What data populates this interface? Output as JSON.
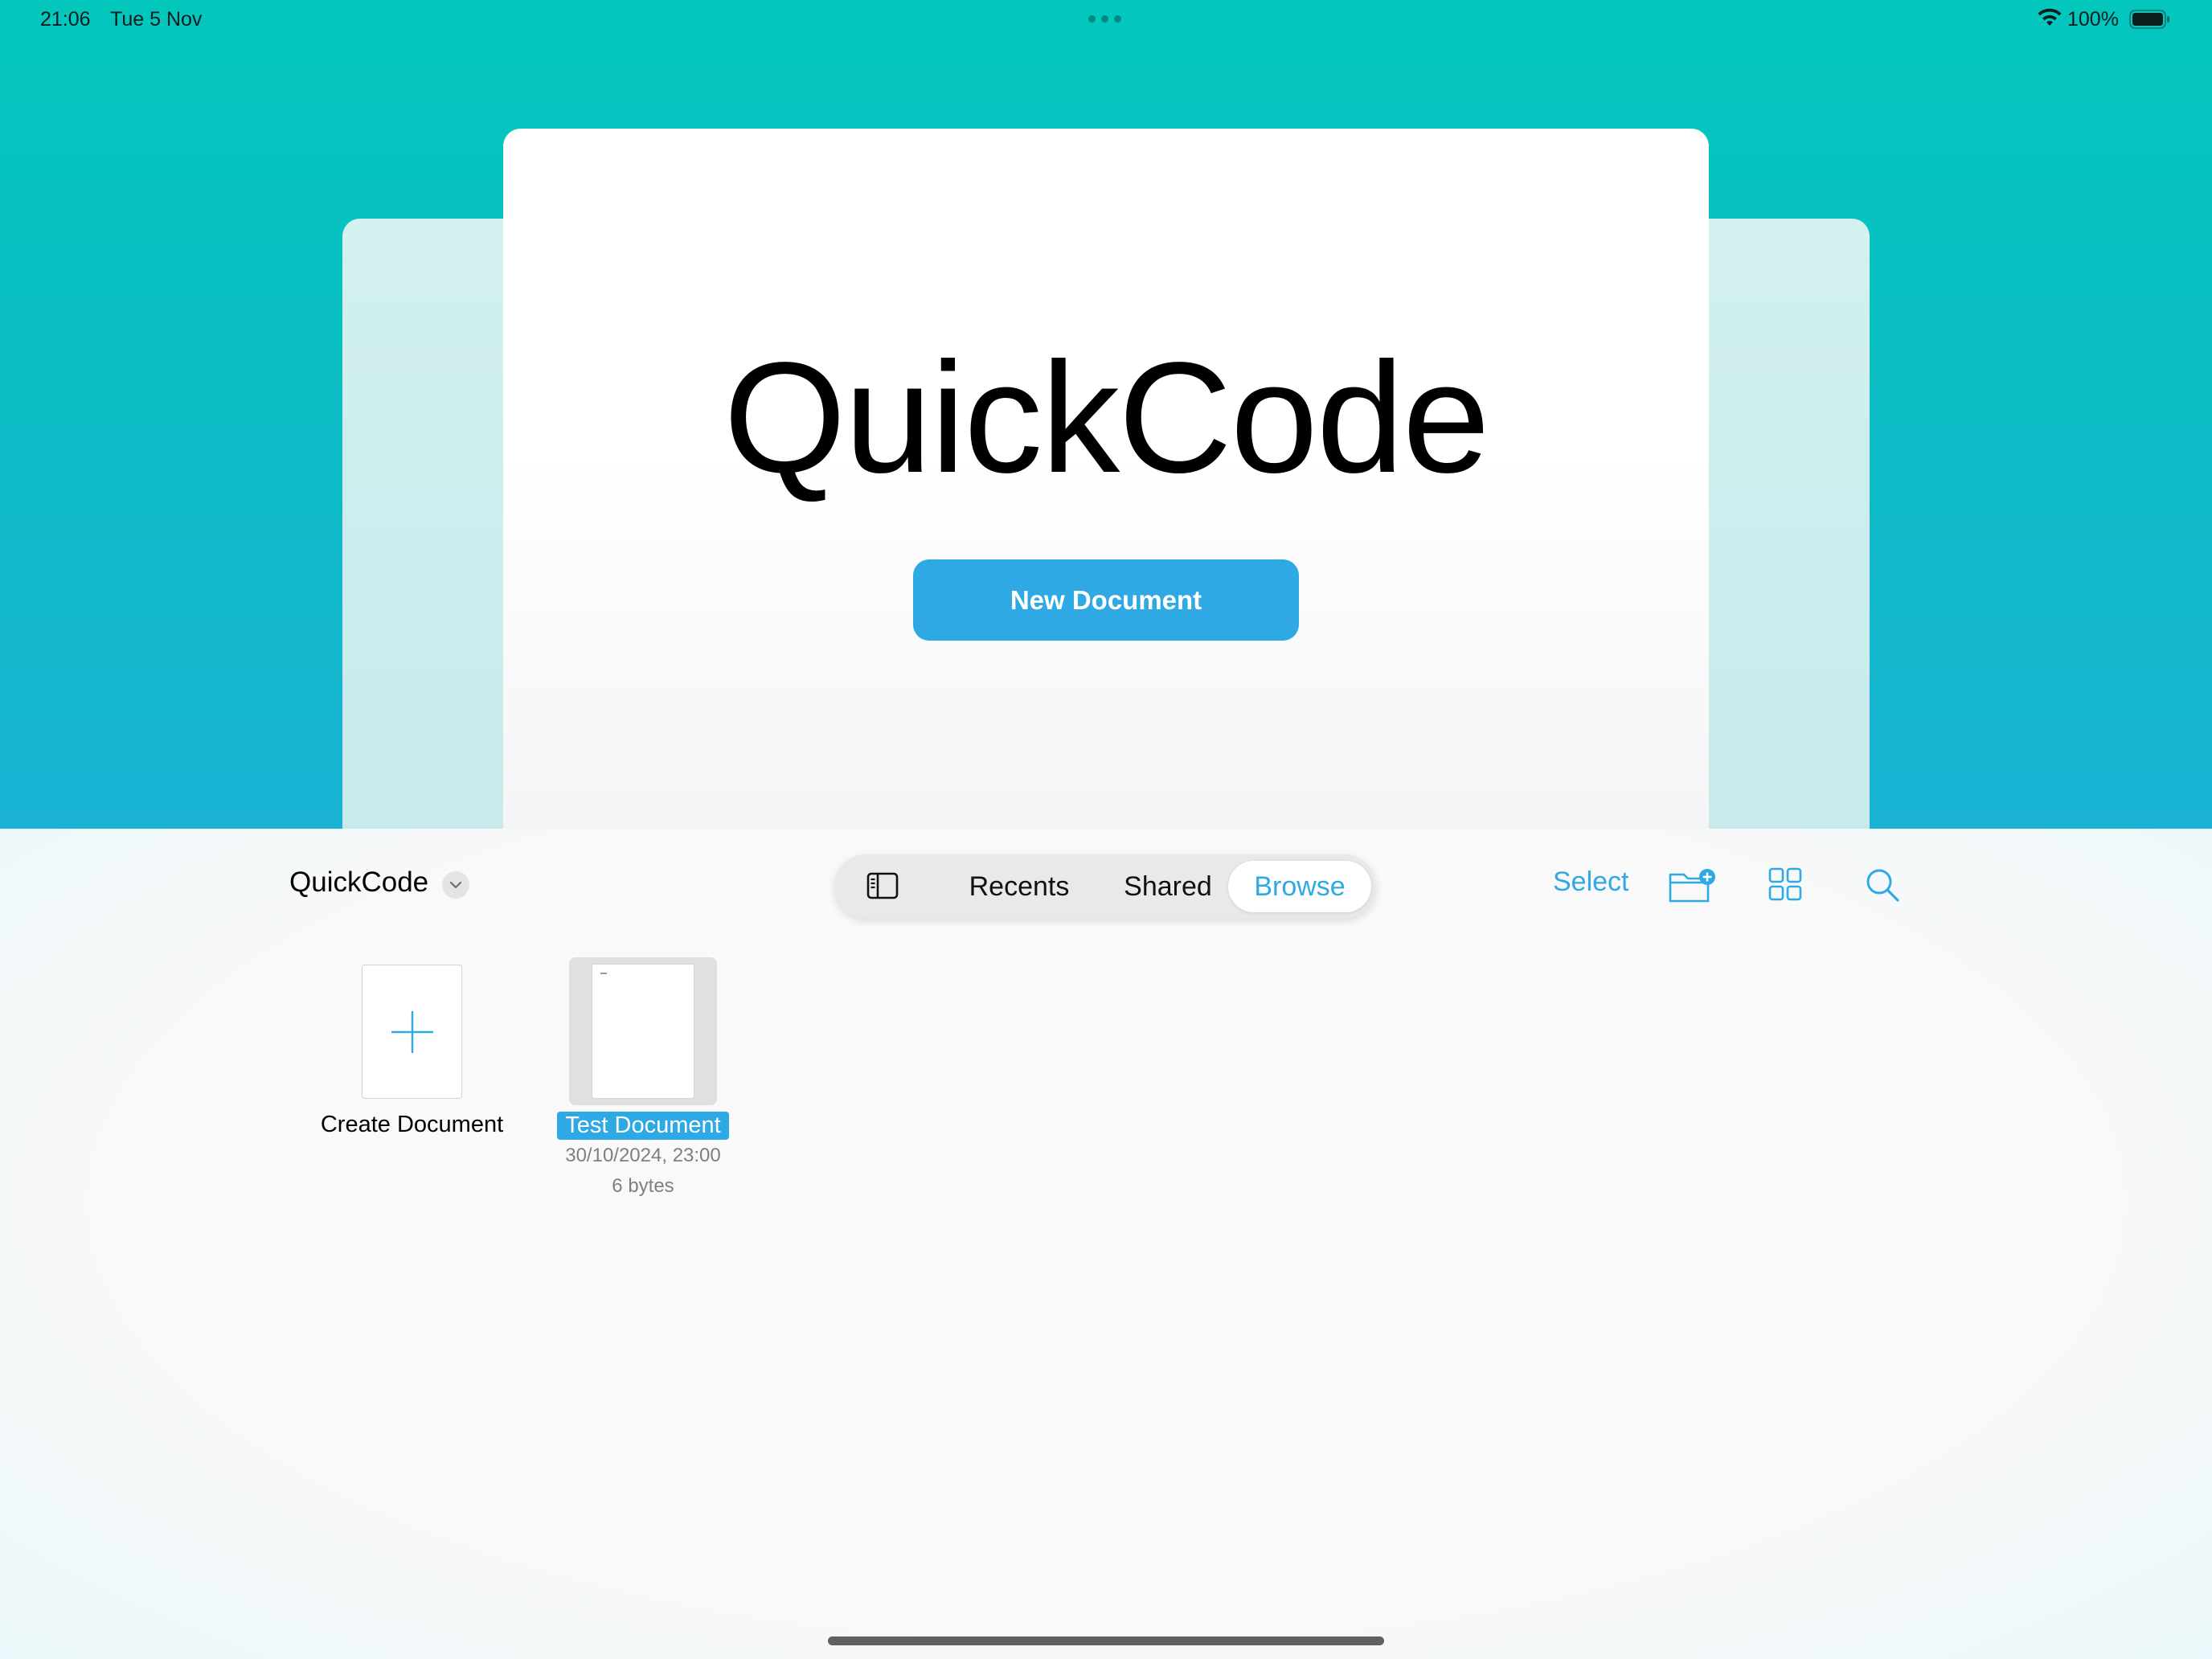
{
  "status_bar": {
    "time": "21:06",
    "date": "Tue 5 Nov",
    "battery": "100%"
  },
  "hero": {
    "app_title": "QuickCode",
    "new_document_label": "New Document"
  },
  "browser": {
    "location_title": "QuickCode",
    "tabs": {
      "recents": "Recents",
      "shared": "Shared",
      "browse": "Browse"
    },
    "selected_tab": "Browse",
    "select_label": "Select",
    "icons": [
      "sidebar-icon",
      "new-folder-icon",
      "grid-view-icon",
      "search-icon",
      "chevron-down-icon",
      "plus-icon"
    ],
    "items": [
      {
        "label": "Create Document"
      },
      {
        "label": "Test Document",
        "date": "30/10/2024, 23:00",
        "size": "6 bytes"
      }
    ]
  },
  "colors": {
    "accent": "#2fa9e3",
    "hero_top": "#03c7bd",
    "hero_bottom": "#1ab2d4"
  }
}
